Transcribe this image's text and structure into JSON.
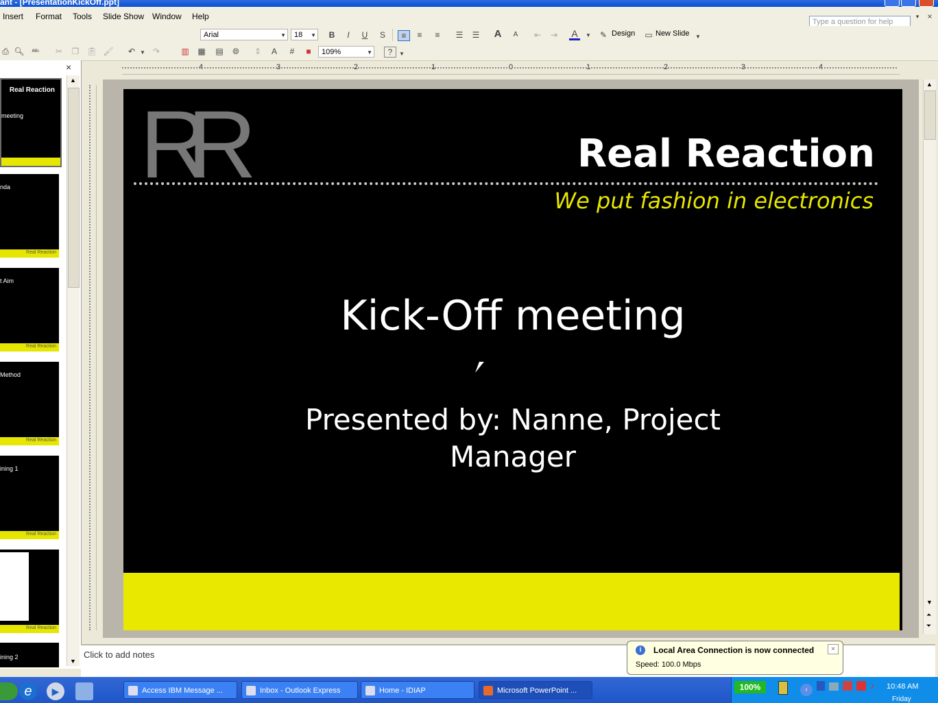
{
  "window": {
    "title": "ant - [PresentationKickOff.ppt]"
  },
  "menu": [
    "Insert",
    "Format",
    "Tools",
    "Slide Show",
    "Window",
    "Help"
  ],
  "help_box": {
    "placeholder": "Type a question for help"
  },
  "formatting": {
    "font": "Arial",
    "size": "18",
    "design_label": "Design",
    "new_slide_label": "New Slide"
  },
  "standard": {
    "zoom": "109%"
  },
  "ruler_labels": [
    "4",
    "3",
    "2",
    "1",
    "0",
    "1",
    "2",
    "3",
    "4"
  ],
  "thumbnails": [
    {
      "title": "meeting",
      "footer": ""
    },
    {
      "title": "nda",
      "footer": "Real Reaction"
    },
    {
      "title": "t Aim",
      "footer": "Real Reaction"
    },
    {
      "title": "Method",
      "footer": "Real Reaction"
    },
    {
      "title": "ining 1",
      "footer": "Real Reaction"
    },
    {
      "title": "",
      "footer": "Real Reaction"
    },
    {
      "title": "ining 2",
      "footer": ""
    }
  ],
  "thumb_first_heading": "Real Reaction",
  "slide": {
    "logo": "RR",
    "company": "Real Reaction",
    "tagline": "We put fashion in electronics",
    "title": "Kick-Off meeting",
    "subtitle_line1": "Presented by: Nanne, Project",
    "subtitle_line2": "Manager"
  },
  "notes": {
    "placeholder": "Click to add notes"
  },
  "balloon": {
    "title": "Local Area Connection is now connected",
    "speed": "Speed: 100.0 Mbps"
  },
  "taskbar": {
    "tasks": [
      "Access IBM Message ...",
      "Inbox - Outlook Express",
      "Home - IDIAP",
      "Microsoft PowerPoint ..."
    ],
    "battery": "100%",
    "clock": "10:48 AM",
    "day": "Friday"
  },
  "colors": {
    "slide_yellow": "#e8e800",
    "tagline": "#e6e600",
    "taskbar": "#245edc"
  }
}
